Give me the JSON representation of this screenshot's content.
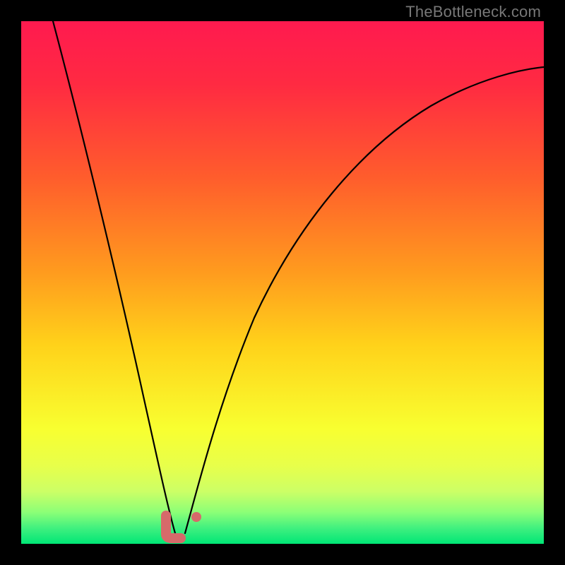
{
  "attribution": "TheBottleneck.com",
  "colors": {
    "frame": "#000000",
    "gradient_stops": [
      {
        "pos": 0.0,
        "color": "#ff1a4f"
      },
      {
        "pos": 0.12,
        "color": "#ff2a42"
      },
      {
        "pos": 0.3,
        "color": "#ff5d2c"
      },
      {
        "pos": 0.48,
        "color": "#ff9b1e"
      },
      {
        "pos": 0.62,
        "color": "#ffd21a"
      },
      {
        "pos": 0.78,
        "color": "#f8ff30"
      },
      {
        "pos": 0.88,
        "color": "#ccff66"
      },
      {
        "pos": 0.94,
        "color": "#8bff77"
      },
      {
        "pos": 1.0,
        "color": "#00e676"
      }
    ],
    "curve": "#000000",
    "marker": "#d66a6a"
  },
  "chart_data": {
    "type": "line",
    "title": "",
    "xlabel": "",
    "ylabel": "",
    "xlim": [
      0,
      100
    ],
    "ylim": [
      0,
      100
    ],
    "x": [
      0,
      2,
      4,
      6,
      8,
      10,
      12,
      14,
      16,
      18,
      20,
      22,
      24,
      26,
      28,
      30,
      32,
      34,
      36,
      38,
      40,
      42,
      44,
      46,
      48,
      50,
      55,
      60,
      65,
      70,
      75,
      80,
      85,
      90,
      95,
      100
    ],
    "values": [
      100,
      90,
      80,
      71,
      62,
      54,
      46,
      39,
      32,
      26,
      20,
      15,
      10,
      6,
      3,
      1,
      2,
      5,
      10,
      17,
      24,
      31,
      38,
      44,
      50,
      55,
      63,
      69,
      74,
      78,
      81,
      84,
      86,
      88,
      89,
      90
    ],
    "minimum": {
      "x": 30,
      "y": 1
    },
    "markers": [
      {
        "type": "L",
        "x": 29,
        "y": 2
      },
      {
        "type": "dot",
        "x": 34,
        "y": 5
      }
    ],
    "note": "Values are percentage estimates read from the plot; the green band at the bottom corresponds to ~0 and red at top to ~100."
  }
}
